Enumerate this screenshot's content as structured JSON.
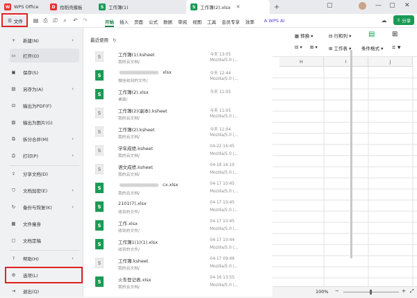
{
  "titlebar": {
    "tabs": [
      {
        "label": "WPS Office",
        "icon": "wps-logo-icon",
        "color": "#e8322f"
      },
      {
        "label": "找稻壳模板",
        "icon": "docer-icon",
        "color": "#e8322f"
      },
      {
        "label": "工作簿(1)",
        "icon": "sheet-icon",
        "color": "#1a9b55"
      },
      {
        "label": "工作簿(2).xlsx",
        "icon": "sheet-icon",
        "color": "#1a9b55"
      }
    ],
    "new_tab": "+"
  },
  "toolbar": {
    "file_label": "文件",
    "menus": [
      "开始",
      "插入",
      "页面",
      "公式",
      "数据",
      "审阅",
      "视图",
      "工具",
      "会员专享",
      "效率"
    ],
    "active_menu": "开始",
    "wps_ai": "WPS AI",
    "share": "分享"
  },
  "ribbon": {
    "convert": "转换",
    "rows_cols": "行和列",
    "worksheet": "工作表",
    "cond_format": "条件格式"
  },
  "sidebar": {
    "items": [
      {
        "label": "新建(N)",
        "icon": "new-file-icon",
        "chevron": true
      },
      {
        "label": "打开(O)",
        "icon": "open-folder-icon",
        "chevron": false
      },
      {
        "label": "保存(S)",
        "icon": "save-icon",
        "chevron": false
      },
      {
        "label": "另存为(A)",
        "icon": "save-as-icon",
        "chevron": true
      },
      {
        "label": "输出为PDF(F)",
        "icon": "pdf-icon",
        "chevron": false
      },
      {
        "label": "输出为图片(G)",
        "icon": "image-export-icon",
        "chevron": false
      },
      {
        "label": "拆分合并(M)",
        "icon": "split-merge-icon",
        "chevron": true
      },
      {
        "label": "打印(P)",
        "icon": "print-icon",
        "chevron": true
      },
      {
        "label": "分享文档(D)",
        "icon": "share-doc-icon",
        "chevron": false
      },
      {
        "label": "文档加密(E)",
        "icon": "encrypt-icon",
        "chevron": true
      },
      {
        "label": "备份与恢复(K)",
        "icon": "backup-icon",
        "chevron": true
      },
      {
        "label": "文件瘦身",
        "icon": "slim-icon",
        "chevron": false
      },
      {
        "label": "文档定稿",
        "icon": "finalize-icon",
        "chevron": false
      },
      {
        "label": "帮助(H)",
        "icon": "help-icon",
        "chevron": true
      },
      {
        "label": "选项(L)",
        "icon": "gear-icon",
        "chevron": false
      },
      {
        "label": "退出(Q)",
        "icon": "exit-icon",
        "chevron": false
      }
    ]
  },
  "recent": {
    "title": "最近使用",
    "files": [
      {
        "name": "工作簿(1).ksheet",
        "loc": "我的云文档/",
        "date": "今天 13:05",
        "app": "Mozilla/5.0 (...",
        "type": "gray"
      },
      {
        "name": "xlsx",
        "name_prefix": "",
        "blurred": true,
        "loc": "微信收到的文件/",
        "date": "今天 12:44",
        "app": "Mozilla/5.0 (...",
        "type": "green"
      },
      {
        "name": "工作簿(2).xlsx",
        "loc": "桌面/",
        "date": "今天 11:05",
        "app": "",
        "type": "green"
      },
      {
        "name": "工作簿(2)(副本).ksheet",
        "loc": "我的云文档/",
        "date": "今天 11:05",
        "app": "Mozilla/5.0 (...",
        "type": "gray"
      },
      {
        "name": "工作簿(2).ksheet",
        "loc": "我的云文档/",
        "date": "今天 11:04",
        "app": "Mozilla/5.0 (...",
        "type": "gray"
      },
      {
        "name": "学年成绩.ksheet",
        "loc": "我的云文档/",
        "date": "04-22 16:45",
        "app": "Mozilla/5.0 (...",
        "type": "gray"
      },
      {
        "name": "语文成绩.ksheet",
        "loc": "我的云文档/",
        "date": "04-18 16:10",
        "app": "Mozilla/5.0 (...",
        "type": "gray"
      },
      {
        "name": "cx.xlsx",
        "blurred": true,
        "loc": "我的云文档/",
        "date": "04-17 10:45",
        "app": "Mozilla/5.0 (...",
        "type": "green"
      },
      {
        "name": "2101(7).xlsx",
        "loc": "收到的文件/",
        "date": "04-17 10:45",
        "app": "Mozilla/5.0 (...",
        "type": "green"
      },
      {
        "name": "工作.xlsx",
        "loc": "收到的文件/",
        "date": "04-17 10:45",
        "app": "Mozilla/5.0 (...",
        "type": "green"
      },
      {
        "name": "工作簿1(1)(1).xlsx",
        "loc": "收到的文件/",
        "date": "04-17 10:44",
        "app": "Mozilla/5.0 (...",
        "type": "green"
      },
      {
        "name": "工作簿.ksheet",
        "loc": "我的云文档/",
        "date": "04-17 09:49",
        "app": "Mozilla/5.0 (...",
        "type": "gray"
      },
      {
        "name": "火车登记表.xlsx",
        "loc": "我的云文档/",
        "date": "04-16 13:55",
        "app": "Mozilla/5.0 (...",
        "type": "green"
      }
    ]
  },
  "grid": {
    "columns": [
      "H",
      "I",
      "J"
    ]
  },
  "status": {
    "zoom": "100%"
  }
}
